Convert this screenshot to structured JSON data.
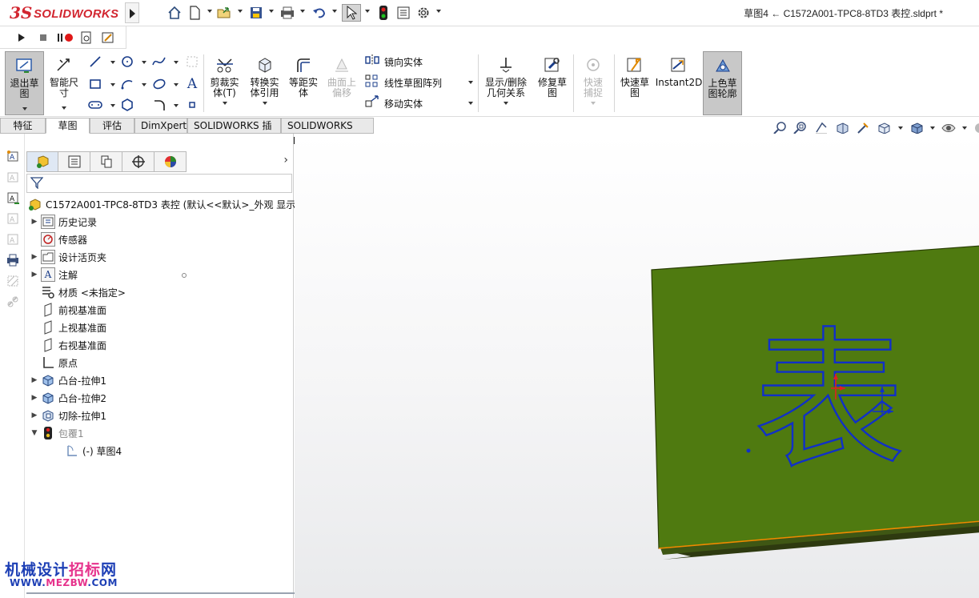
{
  "app": {
    "logo_ds": "3S",
    "logo_text": "SOLIDWORKS",
    "document_title": "草图4 ← C1572A001-TPC8-8TD3 表控.sldprt *"
  },
  "quick_access": [
    "home-icon",
    "new-document-icon",
    "open-folder-icon",
    "save-icon",
    "print-icon",
    "undo-icon",
    "select-cursor-icon",
    "rebuild-traffic-light-icon",
    "file-properties-icon",
    "options-gear-icon"
  ],
  "macro_bar": [
    "play-icon",
    "stop-icon",
    "record-pause-icon",
    "new-macro-icon",
    "edit-macro-icon"
  ],
  "command_manager": {
    "exit_sketch": "退出草图",
    "smart_dimension": "智能尺寸",
    "trim_entities": "剪裁实体(T)",
    "convert_entities": "转换实体引用",
    "offset_entities": "等距实体",
    "offset_on_surface": "曲面上偏移",
    "mirror_entities": "镜向实体",
    "linear_pattern": "线性草图阵列",
    "move_entities": "移动实体",
    "display_delete_relations": "显示/删除几何关系",
    "repair_sketch": "修复草图",
    "quick_snaps": "快速捕捉",
    "rapid_sketch": "快速草图",
    "instant2d": "Instant2D",
    "shaded_contours": "上色草图轮廓"
  },
  "tabs": [
    {
      "label": "特征",
      "active": false
    },
    {
      "label": "草图",
      "active": true
    },
    {
      "label": "评估",
      "active": false
    },
    {
      "label": "DimXpert",
      "active": false
    },
    {
      "label": "SOLIDWORKS 插件",
      "active": false
    },
    {
      "label": "SOLIDWORKS MBD",
      "active": false
    }
  ],
  "feature_tree": {
    "root": "C1572A001-TPC8-8TD3 表控 (默认<<默认>_外观 显示",
    "items": [
      {
        "label": "历史记录",
        "icon": "history-icon",
        "expandable": true
      },
      {
        "label": "传感器",
        "icon": "sensor-icon",
        "expandable": false
      },
      {
        "label": "设计活页夹",
        "icon": "design-binder-icon",
        "expandable": true
      },
      {
        "label": "注解",
        "icon": "annotations-icon",
        "expandable": true
      },
      {
        "label": "材质 <未指定>",
        "icon": "material-icon",
        "expandable": false
      },
      {
        "label": "前视基准面",
        "icon": "plane-icon",
        "expandable": false
      },
      {
        "label": "上视基准面",
        "icon": "plane-icon",
        "expandable": false
      },
      {
        "label": "右视基准面",
        "icon": "plane-icon",
        "expandable": false
      },
      {
        "label": "原点",
        "icon": "origin-icon",
        "expandable": false
      },
      {
        "label": "凸台-拉伸1",
        "icon": "boss-extrude-icon",
        "expandable": true
      },
      {
        "label": "凸台-拉伸2",
        "icon": "boss-extrude-icon",
        "expandable": true
      },
      {
        "label": "切除-拉伸1",
        "icon": "cut-extrude-icon",
        "expandable": true
      },
      {
        "label": "包覆1",
        "icon": "wrap-icon",
        "expandable": true
      },
      {
        "label": "(-) 草图4",
        "icon": "sketch-icon",
        "expandable": false
      }
    ]
  },
  "graphics": {
    "sketch_character": "表",
    "plate_color": "#4f7a10",
    "sketch_color": "#1030c8"
  },
  "watermark": {
    "cn_a": "机械设计",
    "cn_b": "招标",
    "cn_c": "网",
    "url_a": "WWW.",
    "url_b": "MEZBW",
    "url_c": ".COM"
  }
}
